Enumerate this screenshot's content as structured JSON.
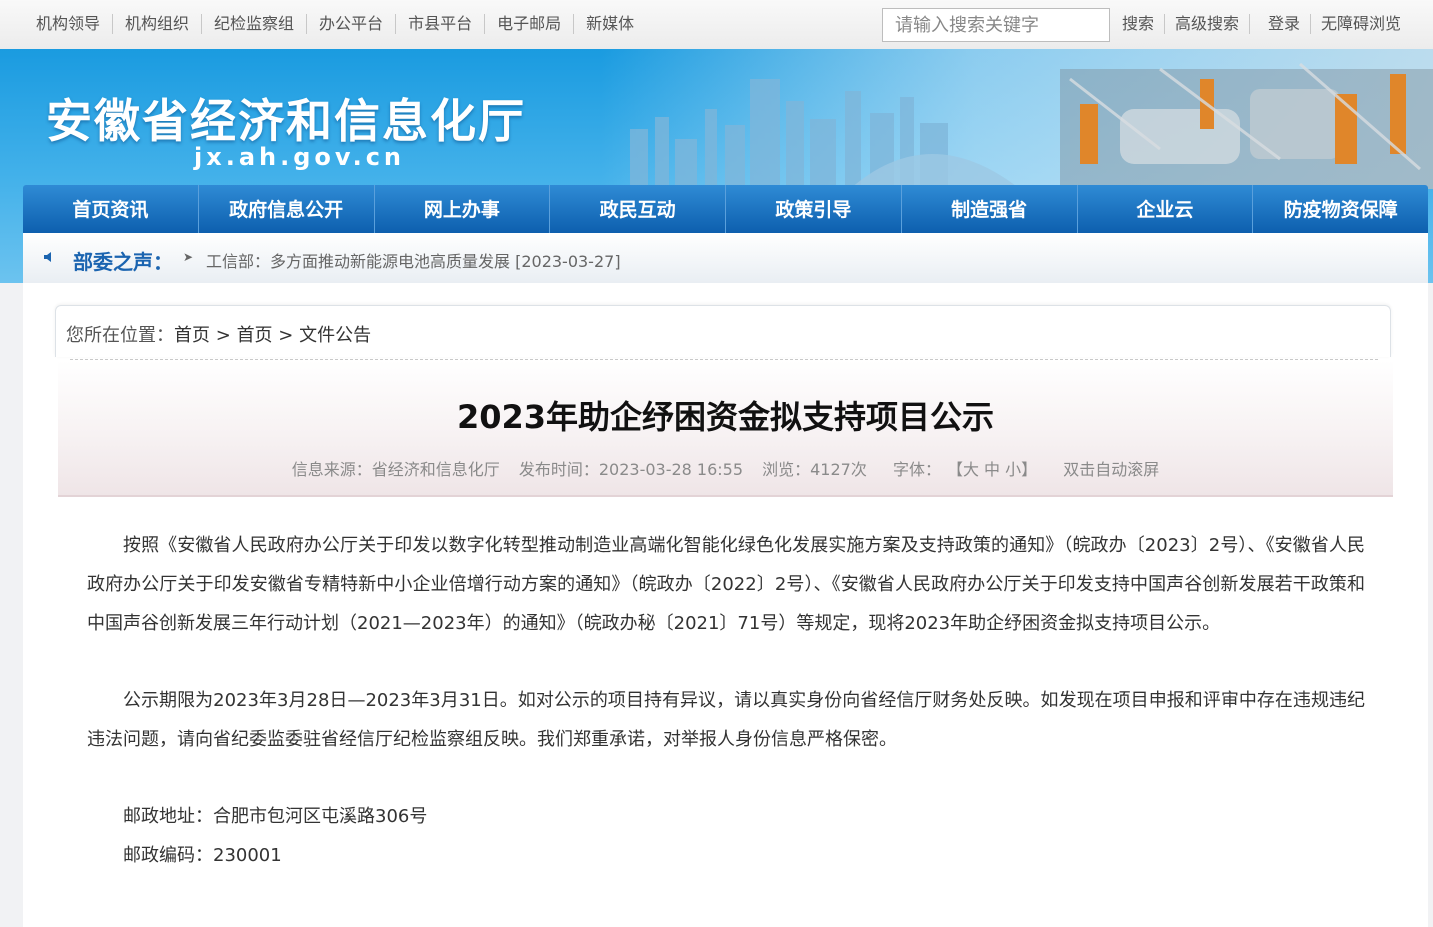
{
  "topbar": {
    "links": [
      "机构领导",
      "机构组织",
      "纪检监察组",
      "办公平台",
      "市县平台",
      "电子邮局",
      "新媒体"
    ],
    "search_placeholder": "请输入搜索关键字",
    "search_button": "搜索",
    "advanced_search": "高级搜索",
    "login": "登录",
    "accessibility": "无障碍浏览"
  },
  "banner": {
    "title": "安徽省经济和信息化厅",
    "domain": "jx.ah.gov.cn"
  },
  "nav": [
    "首页资讯",
    "政府信息公开",
    "网上办事",
    "政民互动",
    "政策引导",
    "制造强省",
    "企业云",
    "防疫物资保障"
  ],
  "notice": {
    "label": "部委之声：",
    "message": "工信部：多方面推动新能源电池高质量发展 [2023-03-27]"
  },
  "breadcrumb": {
    "prefix": "您所在位置：",
    "items": [
      "首页",
      "首页",
      "文件公告"
    ],
    "separator": ">"
  },
  "article": {
    "title": "2023年助企纾困资金拟支持项目公示",
    "source": "信息来源：省经济和信息化厅",
    "published": "发布时间：2023-03-28 16:55",
    "views": "浏览：4127次",
    "font_label": "字体：",
    "font_sizes": "【大 中 小】",
    "autoscroll": "双击自动滚屏",
    "paragraphs": [
      "按照《安徽省人民政府办公厅关于印发以数字化转型推动制造业高端化智能化绿色化发展实施方案及支持政策的通知》（皖政办〔2023〕2号）、《安徽省人民政府办公厅关于印发安徽省专精特新中小企业倍增行动方案的通知》（皖政办〔2022〕2号）、《安徽省人民政府办公厅关于印发支持中国声谷创新发展若干政策和中国声谷创新发展三年行动计划（2021—2023年）的通知》（皖政办秘〔2021〕71号）等规定，现将2023年助企纾困资金拟支持项目公示。",
      "公示期限为2023年3月28日—2023年3月31日。如对公示的项目持有异议，请以真实身份向省经信厅财务处反映。如发现在项目申报和评审中存在违规违纪违法问题，请向省纪委监委驻省经信厅纪检监察组反映。我们郑重承诺，对举报人身份信息严格保密。"
    ],
    "address": "邮政地址：合肥市包河区屯溪路306号",
    "postcode": "邮政编码：230001"
  },
  "colors": {
    "nav": "#0d5fae",
    "banner": "#1a9be0",
    "notice_label": "#1b64b0"
  }
}
